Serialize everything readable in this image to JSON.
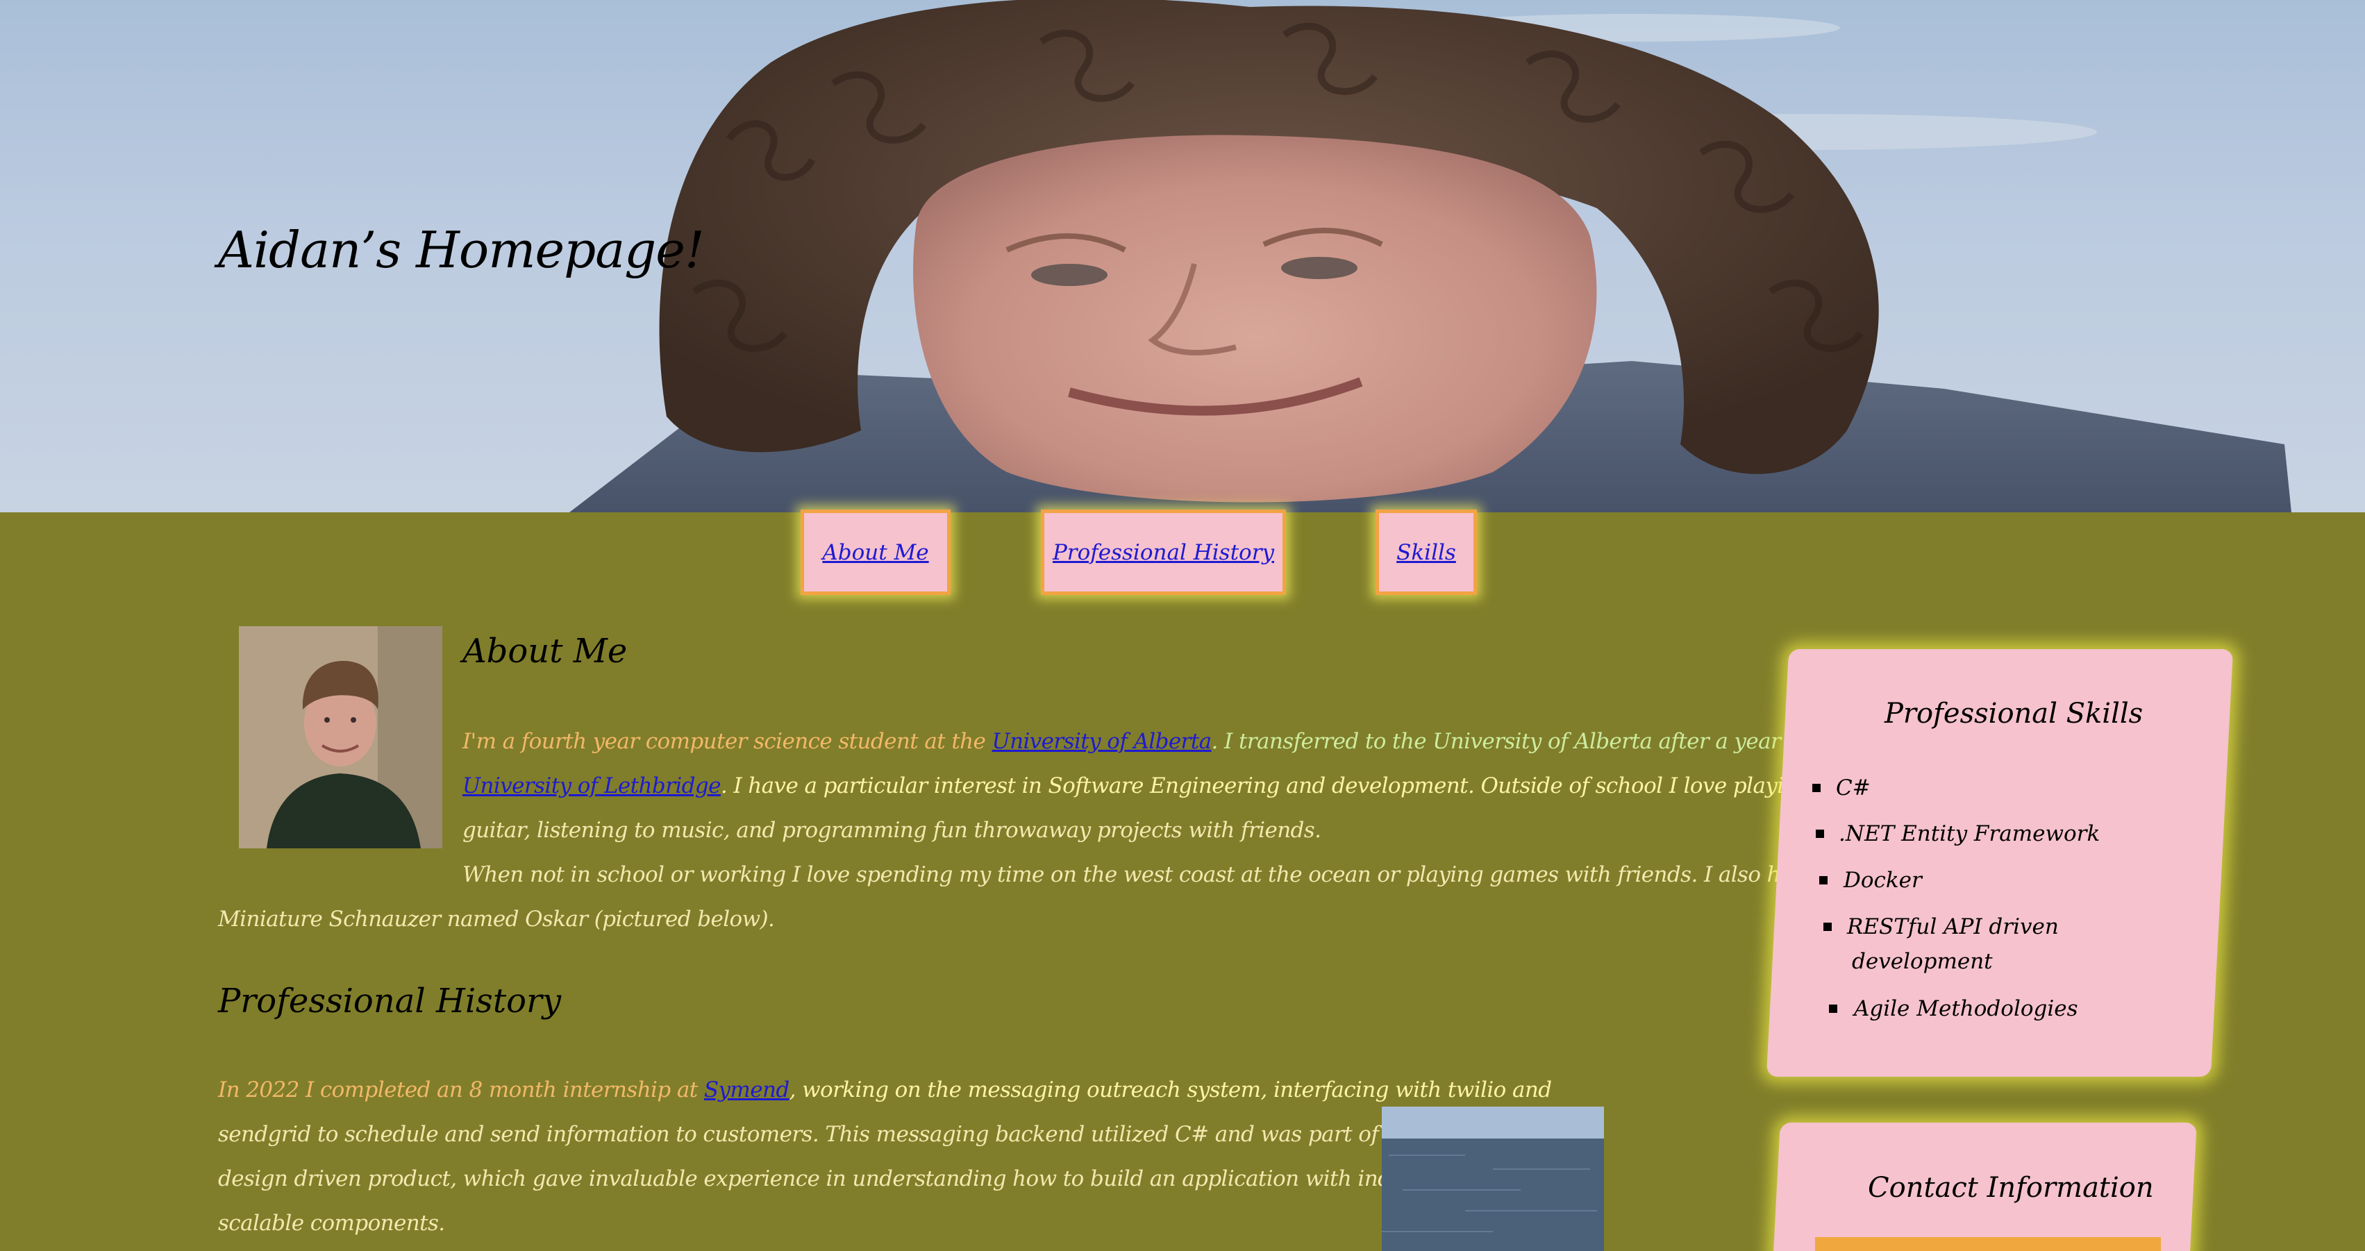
{
  "site": {
    "title": "Aidan’s Homepage!"
  },
  "nav": {
    "items": [
      {
        "label": "About Me"
      },
      {
        "label": "Professional History"
      },
      {
        "label": "Skills"
      }
    ]
  },
  "about": {
    "heading": "About Me",
    "p1_a": "I'm a fourth year computer science student at the ",
    "p1_link1": "University of Alberta",
    "p1_b": ". I transferred to the University of Alberta after a year at",
    "p1_link2": "University of Lethbridge",
    "p1_c": ". I have a particular interest in Software Engineering and development. Outside of school I love playing the",
    "p1_d": "guitar, listening to music, and programming fun throwaway projects with friends.",
    "p2_a": "When not in school or working I love spending my time on the west coast at the ocean or playing games with friends. I also have a",
    "p2_b": "Miniature Schnauzer named Oskar (pictured below)."
  },
  "history": {
    "heading": "Professional History",
    "l1_a": "In 2022 I completed an 8 month internship at ",
    "l1_link": "Symend",
    "l1_b": ", working on the messaging outreach system, interfacing with twilio and",
    "l2": "sendgrid to schedule and send information to customers. This messaging backend utilized C# and was part of a broad API",
    "l3": "design driven product, which gave invaluable experience in understanding how to build an application with independent and",
    "l4": "scalable components."
  },
  "skills": {
    "title": "Professional Skills",
    "items": [
      "C#",
      ".NET Entity Framework",
      "Docker",
      "RESTful API driven",
      "development",
      "Agile Methodologies"
    ]
  },
  "contact": {
    "title": "Contact Information"
  },
  "colors": {
    "background": "#807e2a",
    "card": "#f5c2cd",
    "nav_border": "#f3a344",
    "link": "#1d1ad2",
    "glow": "#f0ec46"
  }
}
